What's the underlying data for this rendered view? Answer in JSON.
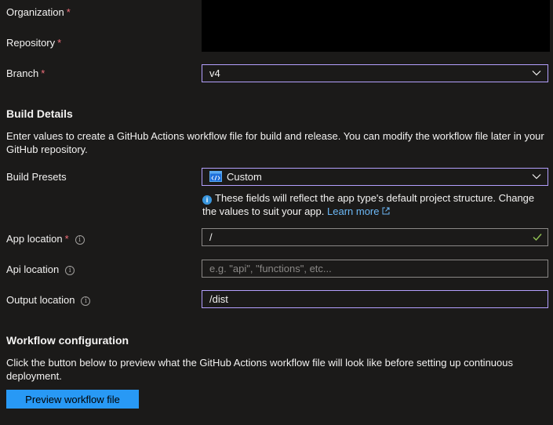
{
  "form": {
    "organization_label": "Organization",
    "repository_label": "Repository",
    "branch_label": "Branch",
    "branch_value": "v4",
    "required_mark": "*"
  },
  "build_details": {
    "heading": "Build Details",
    "description": "Enter values to create a GitHub Actions workflow file for build and release. You can modify the workflow file later in your GitHub repository.",
    "presets_label": "Build Presets",
    "presets_value": "Custom",
    "note_text": "These fields will reflect the app type's default project structure. Change the values to suit your app.",
    "learn_more": "Learn more",
    "app_location_label": "App location",
    "app_location_value": "/",
    "api_location_label": "Api location",
    "api_location_placeholder": "e.g. \"api\", \"functions\", etc...",
    "output_location_label": "Output location",
    "output_location_value": "/dist"
  },
  "workflow": {
    "heading": "Workflow configuration",
    "description": "Click the button below to preview what the GitHub Actions workflow file will look like before setting up continuous deployment.",
    "preview_button": "Preview workflow file"
  },
  "colors": {
    "background": "#1b1a19",
    "focus_border": "#b4a0ff",
    "required": "#f1707b",
    "link": "#6cb8f6",
    "primary_button": "#2899f5",
    "valid_check": "#92c353"
  },
  "icons": [
    "chevron-down-icon",
    "info-icon",
    "custom-preset-icon",
    "external-link-icon",
    "checkmark-icon"
  ]
}
